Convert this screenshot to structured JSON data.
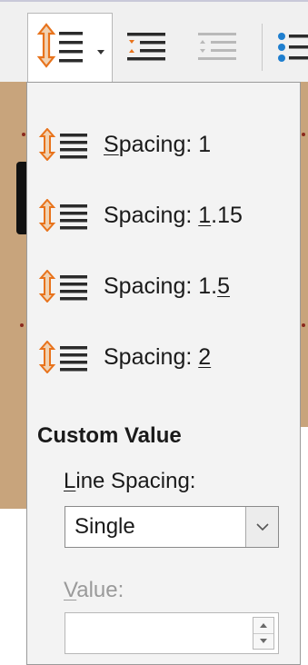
{
  "toolbar": {
    "buttons": [
      {
        "name": "line-spacing-button",
        "icon": "line-spacing-icon"
      },
      {
        "name": "paragraph-spacing-increase",
        "icon": "increase-paragraph-spacing-icon"
      },
      {
        "name": "paragraph-spacing-decrease",
        "icon": "decrease-paragraph-spacing-icon"
      },
      {
        "name": "bullets-button",
        "icon": "bulleted-list-icon"
      }
    ]
  },
  "menu": {
    "items": [
      {
        "prefix": "",
        "mnemonic": "S",
        "suffix": "pacing: 1"
      },
      {
        "prefix": "Spacing: ",
        "mnemonic": "1",
        "suffix": ".15"
      },
      {
        "prefix": "Spacing: 1.",
        "mnemonic": "5",
        "suffix": ""
      },
      {
        "prefix": "Spacing: ",
        "mnemonic": "2",
        "suffix": ""
      }
    ],
    "custom_title": "Custom Value",
    "line_spacing_label": {
      "mnemonic": "L",
      "rest": "ine Spacing:"
    },
    "line_spacing_value": "Single",
    "value_label": {
      "mnemonic": "V",
      "rest": "alue:"
    },
    "value_field": ""
  },
  "colors": {
    "icon_orange": "#e8731c",
    "icon_dark": "#2b2b2b",
    "panel_bg": "#f3f3f3"
  }
}
